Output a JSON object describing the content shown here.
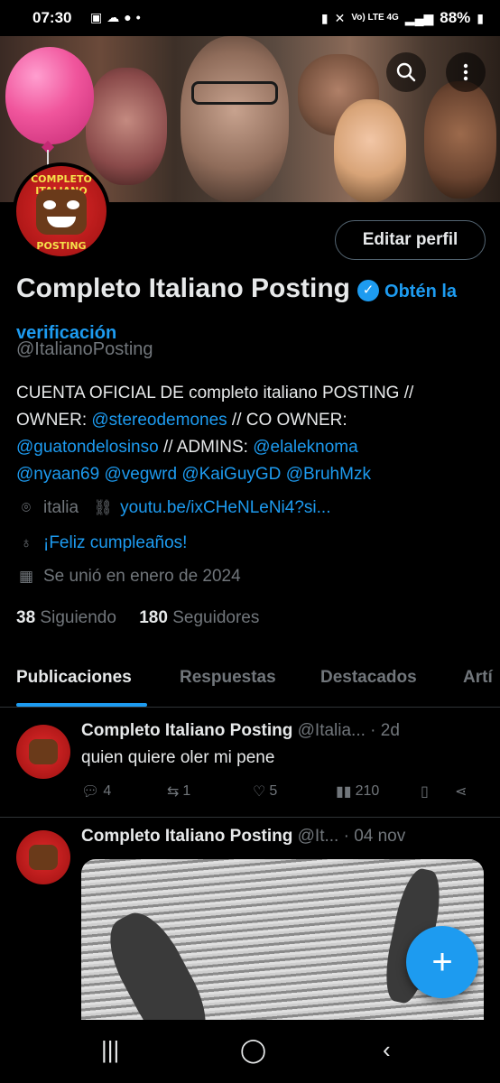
{
  "status_bar": {
    "time": "07:30",
    "notification_icons": [
      "image-icon",
      "cloud-icon",
      "reddit-icon",
      "dot-icon"
    ],
    "network": "Vo) LTE 4G",
    "battery": "88%"
  },
  "header": {
    "search_icon": "search-icon",
    "more_icon": "more-vertical-icon"
  },
  "avatar_text": {
    "top": "COMPLETO ITALIANO",
    "bottom": "POSTING"
  },
  "profile": {
    "edit_button": "Editar perfil",
    "name": "Completo Italiano Posting",
    "get_verified": "Obtén la verificación",
    "handle": "@ItalianoPosting",
    "bio_parts": {
      "p1": "CUENTA OFICIAL DE completo italiano POSTING // OWNER: ",
      "m1": "@stereodemones",
      "p2": " // CO OWNER: ",
      "m2": "@guatondelosinso",
      "p3": " // ADMINS: ",
      "m3": "@elaleknoma",
      "m4": "@nyaan69",
      "m5": "@vegwrd",
      "m6": "@KaiGuyGD",
      "m7": "@BruhMzk"
    },
    "location": "italia",
    "website": "youtu.be/ixCHeNLeNi4?si...",
    "birthday": "¡Feliz cumpleaños!",
    "joined": "Se unió en enero de 2024",
    "following_count": "38",
    "following_label": "Siguiendo",
    "followers_count": "180",
    "followers_label": "Seguidores"
  },
  "tabs": [
    {
      "label": "Publicaciones",
      "active": true
    },
    {
      "label": "Respuestas",
      "active": false
    },
    {
      "label": "Destacados",
      "active": false
    },
    {
      "label": "Artí",
      "active": false
    }
  ],
  "posts": [
    {
      "author": "Completo Italiano Posting",
      "handle_time": "@Italia... · 2d",
      "text": "quien quiere oler mi pene",
      "replies": "4",
      "reposts": "1",
      "likes": "5",
      "views": "210"
    },
    {
      "author": "Completo Italiano Posting",
      "handle_time": "@It... · 04 nov",
      "text": ""
    }
  ],
  "fab_label": "+",
  "colors": {
    "accent": "#1d9bf0",
    "background": "#000000",
    "text_primary": "#e7e9ea",
    "text_secondary": "#71767b"
  }
}
